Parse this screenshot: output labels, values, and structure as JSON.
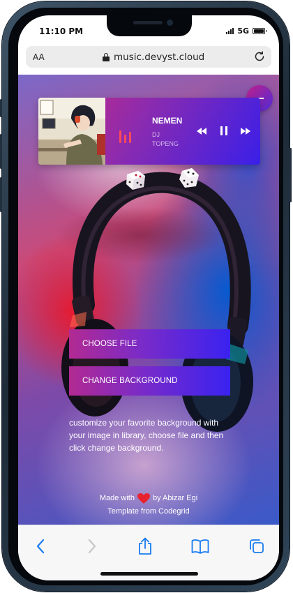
{
  "status_bar": {
    "time": "11:10 PM",
    "network": "5G"
  },
  "browser": {
    "aa_label": "AA",
    "url": "music.devyst.cloud"
  },
  "player": {
    "title": "NEMEN",
    "artist": "DJ TOPENG",
    "cover_icon": "album-art-image",
    "eq_icon": "equalizer-icon"
  },
  "buttons": {
    "choose_file": "CHOOSE FILE",
    "change_background": "CHANGE BACKGROUND"
  },
  "description": "customize your favorite background with your image in library, choose file and then click change background.",
  "footer": {
    "made_with": "Made with",
    "by": "by Abizar Egi",
    "template": "Template from Codegrid"
  },
  "colors": {
    "accent_start": "#d02a7c",
    "accent_end": "#3a1fe8",
    "eq": "#ff4a5a",
    "toolbar_icon": "#1a7cf0"
  },
  "toolbar": {
    "icons": [
      "back-icon",
      "forward-icon",
      "share-icon",
      "bookmarks-icon",
      "tabs-icon"
    ]
  }
}
